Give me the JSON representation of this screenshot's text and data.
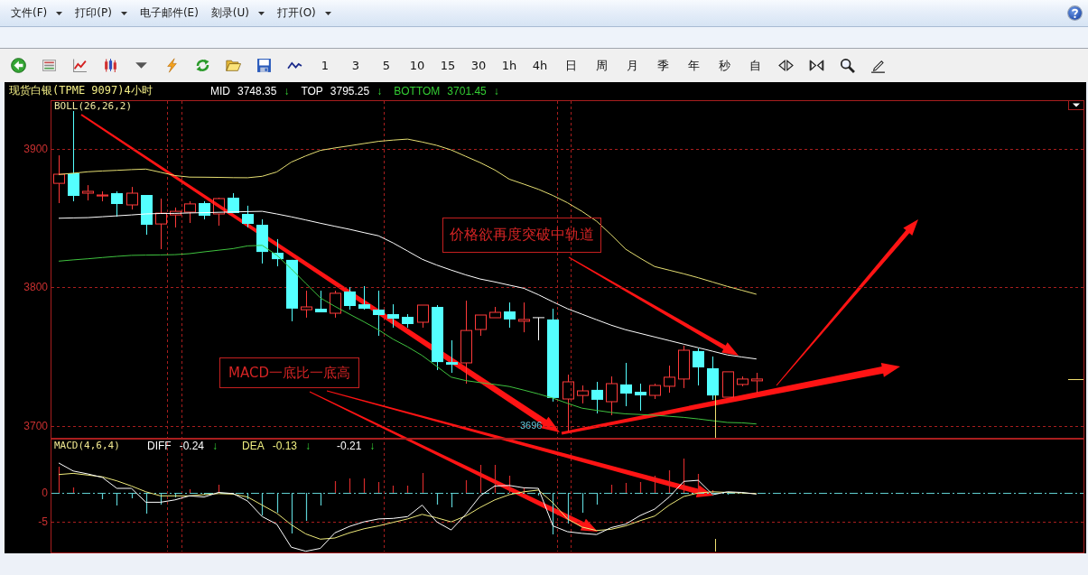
{
  "menu": {
    "items": [
      {
        "label": "文件(F)",
        "dropdown": true
      },
      {
        "label": "打印(P)",
        "dropdown": true
      },
      {
        "label": "电子邮件(E)",
        "dropdown": false
      },
      {
        "label": "刻录(U)",
        "dropdown": true
      },
      {
        "label": "打开(O)",
        "dropdown": true
      }
    ]
  },
  "toolbar": {
    "periods": [
      "1",
      "3",
      "5",
      "10",
      "15",
      "30",
      "1h",
      "4h",
      "日",
      "周",
      "月",
      "季",
      "年",
      "秒",
      "自"
    ]
  },
  "chart": {
    "title": "现货白银(TPME 9097)4小时",
    "readings": [
      {
        "label": "MID",
        "value": "3748.35",
        "arrow": "↓",
        "color": "#ffffff"
      },
      {
        "label": "TOP",
        "value": "3795.25",
        "arrow": "↓",
        "color": "#ffffff"
      },
      {
        "label": "BOTTOM",
        "value": "3701.45",
        "arrow": "↓",
        "color": "#33cc33"
      }
    ]
  },
  "price_panel": {
    "indicator": "BOLL(26,26,2)",
    "low_label": "3696",
    "annotations": [
      "价格欲再度突破中轨道",
      "MACD一底比一底高"
    ],
    "chart_data": {
      "type": "candlestick",
      "grid": true,
      "ylim": [
        3691.5,
        3935.2
      ],
      "yticks": [
        {
          "value": 3900,
          "label": "3900"
        },
        {
          "value": 3800,
          "label": "3800"
        },
        {
          "value": 3700,
          "label": "3700"
        }
      ],
      "categories": [
        null,
        null,
        null,
        null,
        null,
        null,
        null,
        null,
        null,
        null,
        null,
        null,
        null,
        null,
        null,
        null,
        null,
        null,
        null,
        null,
        null,
        null,
        null,
        null,
        null,
        null,
        null,
        null,
        null,
        null,
        null,
        null,
        null,
        null,
        null,
        null,
        null,
        null,
        null,
        null,
        null,
        null,
        null,
        null,
        null,
        null,
        null,
        null,
        null,
        null,
        null,
        null,
        null,
        null,
        null,
        null,
        null,
        null,
        null,
        null,
        null,
        null,
        null,
        null,
        null,
        null,
        null,
        null,
        null,
        null,
        null
      ],
      "ohlc": [
        [
          3875.2,
          3895.4,
          3860.9,
          3881.8
        ],
        [
          3882.4,
          3927.4,
          3862.2,
          3866.1
        ],
        [
          3868.1,
          3873.9,
          3862.9,
          3869.4
        ],
        [
          3866.1,
          3869.4,
          3862.2,
          3866.8
        ],
        [
          3868.1,
          3869.4,
          3851.1,
          3860.3
        ],
        [
          3859.6,
          3872.6,
          3856.3,
          3868.1
        ],
        [
          3866.8,
          3866.8,
          3838.1,
          3845.3
        ],
        [
          3845.9,
          3864.2,
          3827.7,
          3853.7
        ],
        [
          3852.4,
          3857.7,
          3843.3,
          3855.0
        ],
        [
          3854.4,
          3862.2,
          3846.6,
          3860.3
        ],
        [
          3860.9,
          3862.2,
          3849.2,
          3851.8
        ],
        [
          3853.1,
          3864.8,
          3844.6,
          3864.2
        ],
        [
          3864.8,
          3868.1,
          3853.7,
          3853.7
        ],
        [
          3853.1,
          3859.0,
          3843.3,
          3845.9
        ],
        [
          3845.3,
          3849.2,
          3817.3,
          3825.7
        ],
        [
          3825.1,
          3834.9,
          3815.3,
          3820.5
        ],
        [
          3819.9,
          3819.9,
          3775.6,
          3784.7
        ],
        [
          3784.0,
          3797.7,
          3778.2,
          3786.0
        ],
        [
          3784.7,
          3797.7,
          3782.1,
          3782.1
        ],
        [
          3781.4,
          3797.7,
          3778.2,
          3795.8
        ],
        [
          3797.1,
          3800.3,
          3784.0,
          3786.6
        ],
        [
          3787.9,
          3801.0,
          3784.0,
          3784.7
        ],
        [
          3784.0,
          3797.7,
          3765.1,
          3780.1
        ],
        [
          3780.8,
          3787.9,
          3771.0,
          3777.5
        ],
        [
          3778.8,
          3780.8,
          3771.0,
          3773.6
        ],
        [
          3774.9,
          3787.3,
          3771.0,
          3787.3
        ],
        [
          3786.0,
          3787.3,
          3740.4,
          3746.2
        ],
        [
          3746.2,
          3761.9,
          3738.4,
          3744.3
        ],
        [
          3745.6,
          3790.5,
          3730.6,
          3769.0
        ],
        [
          3769.7,
          3780.1,
          3765.1,
          3780.1
        ],
        [
          3778.2,
          3786.0,
          3778.2,
          3782.1
        ],
        [
          3782.7,
          3789.2,
          3771.0,
          3776.9
        ],
        [
          3775.6,
          3789.2,
          3767.7,
          3776.9
        ],
        [
          3778.2,
          3778.2,
          3761.9,
          3778.2
        ],
        [
          3776.9,
          3784.7,
          3717.6,
          3720.2
        ],
        [
          3719.5,
          3737.1,
          3696.1,
          3731.9
        ],
        [
          3722.1,
          3729.3,
          3716.3,
          3725.4
        ],
        [
          3726.1,
          3731.9,
          3709.1,
          3718.9
        ],
        [
          3717.6,
          3735.8,
          3707.8,
          3730.6
        ],
        [
          3730.0,
          3745.6,
          3714.3,
          3723.4
        ],
        [
          3724.7,
          3730.6,
          3711.1,
          3722.1
        ],
        [
          3722.1,
          3730.6,
          3719.5,
          3729.3
        ],
        [
          3728.7,
          3743.6,
          3724.1,
          3735.2
        ],
        [
          3733.9,
          3758.0,
          3727.4,
          3754.7
        ],
        [
          3754.1,
          3756.0,
          3729.3,
          3742.3
        ],
        [
          3741.7,
          3750.2,
          3718.9,
          3722.1
        ],
        [
          3720.8,
          3739.1,
          3720.8,
          3739.1
        ],
        [
          3730.0,
          3735.8,
          3728.7,
          3733.9
        ],
        [
          3732.6,
          3738.4,
          3724.1,
          3733.9
        ],
        null,
        null,
        null,
        null,
        null,
        null,
        null,
        null,
        null,
        null,
        null,
        null,
        null,
        null,
        null,
        null,
        null,
        null,
        null,
        null,
        null,
        null
      ]
    },
    "bands": {
      "chart_data": {
        "type": "line",
        "ylim": [
          3691.5,
          3935.2
        ],
        "categories": [
          null,
          null,
          null,
          null,
          null,
          null,
          null,
          null,
          null,
          null,
          null,
          null,
          null,
          null,
          null,
          null,
          null,
          null,
          null,
          null,
          null,
          null,
          null,
          null,
          null,
          null,
          null,
          null,
          null,
          null,
          null,
          null,
          null,
          null,
          null,
          null,
          null,
          null,
          null,
          null,
          null,
          null,
          null,
          null,
          null,
          null,
          null,
          null,
          null,
          null,
          null,
          null,
          null,
          null,
          null,
          null,
          null,
          null,
          null,
          null,
          null,
          null,
          null,
          null,
          null,
          null,
          null,
          null,
          null,
          null,
          null
        ],
        "series": [
          {
            "color": "#e6df72",
            "values": [
              3881.6,
              3882.5,
              3883.5,
              3884.1,
              3884.6,
              3885.1,
              3885.5,
              3883.2,
              3880.8,
              3879.7,
              3879.6,
              3879.5,
              3879.3,
              3879.2,
              3880.3,
              3883.4,
              3890.5,
              3895.0,
              3899.0,
              3900.7,
              3902.3,
              3903.9,
              3905.5,
              3906.4,
              3907.1,
              3905.0,
              3902.6,
              3899.3,
              3894.7,
              3890.1,
              3884.8,
              3878.2,
              3874.6,
              3870.9,
              3866.4,
              3861.2,
              3854.9,
              3847.9,
              3838.1,
              3827.7,
              3821.2,
              3815.1,
              3812.5,
              3809.9,
              3807.0,
              3803.9,
              3800.8,
              3798.0,
              3795.1,
              null,
              null,
              null,
              null,
              null,
              null,
              null,
              null,
              null,
              null,
              null,
              null,
              null,
              null,
              null,
              null,
              null,
              null,
              null,
              null,
              null,
              null
            ]
          },
          {
            "color": "#ffffff",
            "values": [
              3850.0,
              3850.2,
              3850.4,
              3851.1,
              3851.7,
              3852.4,
              3853.1,
              3853.4,
              3853.5,
              3853.8,
              3854.0,
              3854.3,
              3854.5,
              3854.8,
              3855.0,
              3853.1,
              3851.0,
              3848.7,
              3846.4,
              3844.2,
              3842.0,
              3839.6,
              3837.3,
              3832.2,
              3826.3,
              3820.4,
              3816.2,
              3812.6,
              3809.1,
              3806.1,
              3804.0,
              3801.7,
              3799.4,
              3794.8,
              3789.6,
              3784.7,
              3780.7,
              3776.7,
              3772.8,
              3769.5,
              3766.9,
              3764.3,
              3761.7,
              3759.1,
              3756.5,
              3753.9,
              3751.3,
              3749.8,
              3748.4,
              null,
              null,
              null,
              null,
              null,
              null,
              null,
              null,
              null,
              null,
              null,
              null,
              null,
              null,
              null,
              null,
              null,
              null,
              null,
              null,
              null,
              null
            ]
          },
          {
            "color": "#3fc23f",
            "values": [
              3819.0,
              3819.9,
              3820.7,
              3821.6,
              3822.5,
              3823.2,
              3823.4,
              3823.5,
              3823.7,
              3824.4,
              3825.7,
              3826.9,
              3828.1,
              3830.0,
              3830.4,
              3823.3,
              3813.4,
              3802.9,
              3792.5,
              3786.4,
              3780.8,
              3775.2,
              3769.4,
              3762.7,
              3757.2,
              3750.9,
              3743.1,
              3735.3,
              3732.8,
              3731.3,
              3730.0,
              3728.5,
              3725.9,
              3723.2,
              3720.1,
              3716.4,
              3712.9,
              3711.3,
              3709.8,
              3708.8,
              3708.3,
              3707.8,
              3707.0,
              3706.2,
              3705.1,
              3703.8,
              3702.6,
              3702.3,
              3701.5,
              null,
              null,
              null,
              null,
              null,
              null,
              null,
              null,
              null,
              null,
              null,
              null,
              null,
              null,
              null,
              null,
              null,
              null,
              null,
              null,
              null,
              null
            ]
          }
        ]
      }
    }
  },
  "macd_panel": {
    "indicator": "MACD(4,6,4)",
    "readings": [
      {
        "label": "DIFF",
        "value": "-0.24",
        "arrow": "↓",
        "color": "#ffffff"
      },
      {
        "label": "DEA",
        "value": "-0.13",
        "arrow": "↓",
        "color": "#f0f080"
      },
      {
        "value": "-0.21",
        "arrow": "↓",
        "color": "#ffffff"
      }
    ],
    "chart_data": {
      "type": "line",
      "grid": true,
      "ylim": [
        -10.3,
        9.4
      ],
      "yticks": [
        {
          "value": 0,
          "label": "0"
        },
        {
          "value": -5,
          "label": "-5"
        }
      ],
      "categories": [
        null,
        null,
        null,
        null,
        null,
        null,
        null,
        null,
        null,
        null,
        null,
        null,
        null,
        null,
        null,
        null,
        null,
        null,
        null,
        null,
        null,
        null,
        null,
        null,
        null,
        null,
        null,
        null,
        null,
        null,
        null,
        null,
        null,
        null,
        null,
        null,
        null,
        null,
        null,
        null,
        null,
        null,
        null,
        null,
        null,
        null,
        null,
        null,
        null,
        null,
        null,
        null,
        null,
        null,
        null,
        null,
        null,
        null,
        null,
        null,
        null,
        null,
        null,
        null,
        null,
        null,
        null,
        null,
        null,
        null,
        null
      ],
      "series": [
        {
          "color": "#eeea7a",
          "values": [
            3.2,
            3.4,
            3.1,
            2.8,
            2.1,
            1.2,
            0.2,
            -0.5,
            -0.5,
            -0.5,
            -0.3,
            -0.1,
            -0.2,
            -0.7,
            -2.1,
            -3.5,
            -5.5,
            -7.1,
            -8.0,
            -7.8,
            -6.9,
            -6.2,
            -5.7,
            -5.1,
            -4.5,
            -3.7,
            -4.3,
            -5.0,
            -4.0,
            -2.5,
            -1.2,
            -0.3,
            0.2,
            0.5,
            -1.7,
            -4.5,
            -5.9,
            -6.5,
            -6.3,
            -5.7,
            -4.8,
            -4.0,
            -2.1,
            -0.6,
            0.0,
            0.2,
            0.1,
            0.0,
            -0.1,
            null,
            null,
            null,
            null,
            null,
            null,
            null,
            null,
            null,
            null,
            null,
            null,
            null,
            null,
            null,
            null,
            null,
            null,
            null,
            null,
            null,
            null
          ]
        },
        {
          "color": "#ffffff",
          "values": [
            5.2,
            3.8,
            3.3,
            2.7,
            0.8,
            0.8,
            -1.6,
            -1.6,
            -1.2,
            -0.5,
            -0.7,
            0.1,
            -0.1,
            -1.4,
            -4.1,
            -5.4,
            -9.4,
            -10.1,
            -9.6,
            -6.9,
            -5.8,
            -5.0,
            -4.5,
            -4.4,
            -4.1,
            -2.1,
            -5.0,
            -6.4,
            -3.7,
            -0.5,
            1.2,
            1.3,
            0.9,
            0.8,
            -5.7,
            -6.7,
            -7.0,
            -7.2,
            -6.0,
            -5.4,
            -3.9,
            -2.8,
            -0.7,
            2.0,
            2.2,
            -0.3,
            0.2,
            0.1,
            -0.2,
            null,
            null,
            null,
            null,
            null,
            null,
            null,
            null,
            null,
            null,
            null,
            null,
            null,
            null,
            null,
            null,
            null,
            null,
            null,
            null,
            null,
            null
          ]
        }
      ]
    }
  }
}
